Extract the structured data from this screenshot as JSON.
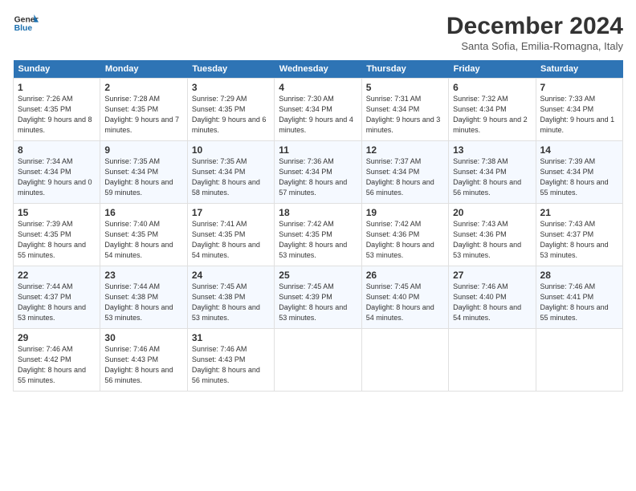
{
  "header": {
    "logo_line1": "General",
    "logo_line2": "Blue",
    "month": "December 2024",
    "location": "Santa Sofia, Emilia-Romagna, Italy"
  },
  "weekdays": [
    "Sunday",
    "Monday",
    "Tuesday",
    "Wednesday",
    "Thursday",
    "Friday",
    "Saturday"
  ],
  "weeks": [
    [
      {
        "day": "1",
        "info": "Sunrise: 7:26 AM\nSunset: 4:35 PM\nDaylight: 9 hours\nand 8 minutes."
      },
      {
        "day": "2",
        "info": "Sunrise: 7:28 AM\nSunset: 4:35 PM\nDaylight: 9 hours\nand 7 minutes."
      },
      {
        "day": "3",
        "info": "Sunrise: 7:29 AM\nSunset: 4:35 PM\nDaylight: 9 hours\nand 6 minutes."
      },
      {
        "day": "4",
        "info": "Sunrise: 7:30 AM\nSunset: 4:34 PM\nDaylight: 9 hours\nand 4 minutes."
      },
      {
        "day": "5",
        "info": "Sunrise: 7:31 AM\nSunset: 4:34 PM\nDaylight: 9 hours\nand 3 minutes."
      },
      {
        "day": "6",
        "info": "Sunrise: 7:32 AM\nSunset: 4:34 PM\nDaylight: 9 hours\nand 2 minutes."
      },
      {
        "day": "7",
        "info": "Sunrise: 7:33 AM\nSunset: 4:34 PM\nDaylight: 9 hours\nand 1 minute."
      }
    ],
    [
      {
        "day": "8",
        "info": "Sunrise: 7:34 AM\nSunset: 4:34 PM\nDaylight: 9 hours\nand 0 minutes."
      },
      {
        "day": "9",
        "info": "Sunrise: 7:35 AM\nSunset: 4:34 PM\nDaylight: 8 hours\nand 59 minutes."
      },
      {
        "day": "10",
        "info": "Sunrise: 7:35 AM\nSunset: 4:34 PM\nDaylight: 8 hours\nand 58 minutes."
      },
      {
        "day": "11",
        "info": "Sunrise: 7:36 AM\nSunset: 4:34 PM\nDaylight: 8 hours\nand 57 minutes."
      },
      {
        "day": "12",
        "info": "Sunrise: 7:37 AM\nSunset: 4:34 PM\nDaylight: 8 hours\nand 56 minutes."
      },
      {
        "day": "13",
        "info": "Sunrise: 7:38 AM\nSunset: 4:34 PM\nDaylight: 8 hours\nand 56 minutes."
      },
      {
        "day": "14",
        "info": "Sunrise: 7:39 AM\nSunset: 4:34 PM\nDaylight: 8 hours\nand 55 minutes."
      }
    ],
    [
      {
        "day": "15",
        "info": "Sunrise: 7:39 AM\nSunset: 4:35 PM\nDaylight: 8 hours\nand 55 minutes."
      },
      {
        "day": "16",
        "info": "Sunrise: 7:40 AM\nSunset: 4:35 PM\nDaylight: 8 hours\nand 54 minutes."
      },
      {
        "day": "17",
        "info": "Sunrise: 7:41 AM\nSunset: 4:35 PM\nDaylight: 8 hours\nand 54 minutes."
      },
      {
        "day": "18",
        "info": "Sunrise: 7:42 AM\nSunset: 4:35 PM\nDaylight: 8 hours\nand 53 minutes."
      },
      {
        "day": "19",
        "info": "Sunrise: 7:42 AM\nSunset: 4:36 PM\nDaylight: 8 hours\nand 53 minutes."
      },
      {
        "day": "20",
        "info": "Sunrise: 7:43 AM\nSunset: 4:36 PM\nDaylight: 8 hours\nand 53 minutes."
      },
      {
        "day": "21",
        "info": "Sunrise: 7:43 AM\nSunset: 4:37 PM\nDaylight: 8 hours\nand 53 minutes."
      }
    ],
    [
      {
        "day": "22",
        "info": "Sunrise: 7:44 AM\nSunset: 4:37 PM\nDaylight: 8 hours\nand 53 minutes."
      },
      {
        "day": "23",
        "info": "Sunrise: 7:44 AM\nSunset: 4:38 PM\nDaylight: 8 hours\nand 53 minutes."
      },
      {
        "day": "24",
        "info": "Sunrise: 7:45 AM\nSunset: 4:38 PM\nDaylight: 8 hours\nand 53 minutes."
      },
      {
        "day": "25",
        "info": "Sunrise: 7:45 AM\nSunset: 4:39 PM\nDaylight: 8 hours\nand 53 minutes."
      },
      {
        "day": "26",
        "info": "Sunrise: 7:45 AM\nSunset: 4:40 PM\nDaylight: 8 hours\nand 54 minutes."
      },
      {
        "day": "27",
        "info": "Sunrise: 7:46 AM\nSunset: 4:40 PM\nDaylight: 8 hours\nand 54 minutes."
      },
      {
        "day": "28",
        "info": "Sunrise: 7:46 AM\nSunset: 4:41 PM\nDaylight: 8 hours\nand 55 minutes."
      }
    ],
    [
      {
        "day": "29",
        "info": "Sunrise: 7:46 AM\nSunset: 4:42 PM\nDaylight: 8 hours\nand 55 minutes."
      },
      {
        "day": "30",
        "info": "Sunrise: 7:46 AM\nSunset: 4:43 PM\nDaylight: 8 hours\nand 56 minutes."
      },
      {
        "day": "31",
        "info": "Sunrise: 7:46 AM\nSunset: 4:43 PM\nDaylight: 8 hours\nand 56 minutes."
      },
      {
        "day": "",
        "info": ""
      },
      {
        "day": "",
        "info": ""
      },
      {
        "day": "",
        "info": ""
      },
      {
        "day": "",
        "info": ""
      }
    ]
  ]
}
